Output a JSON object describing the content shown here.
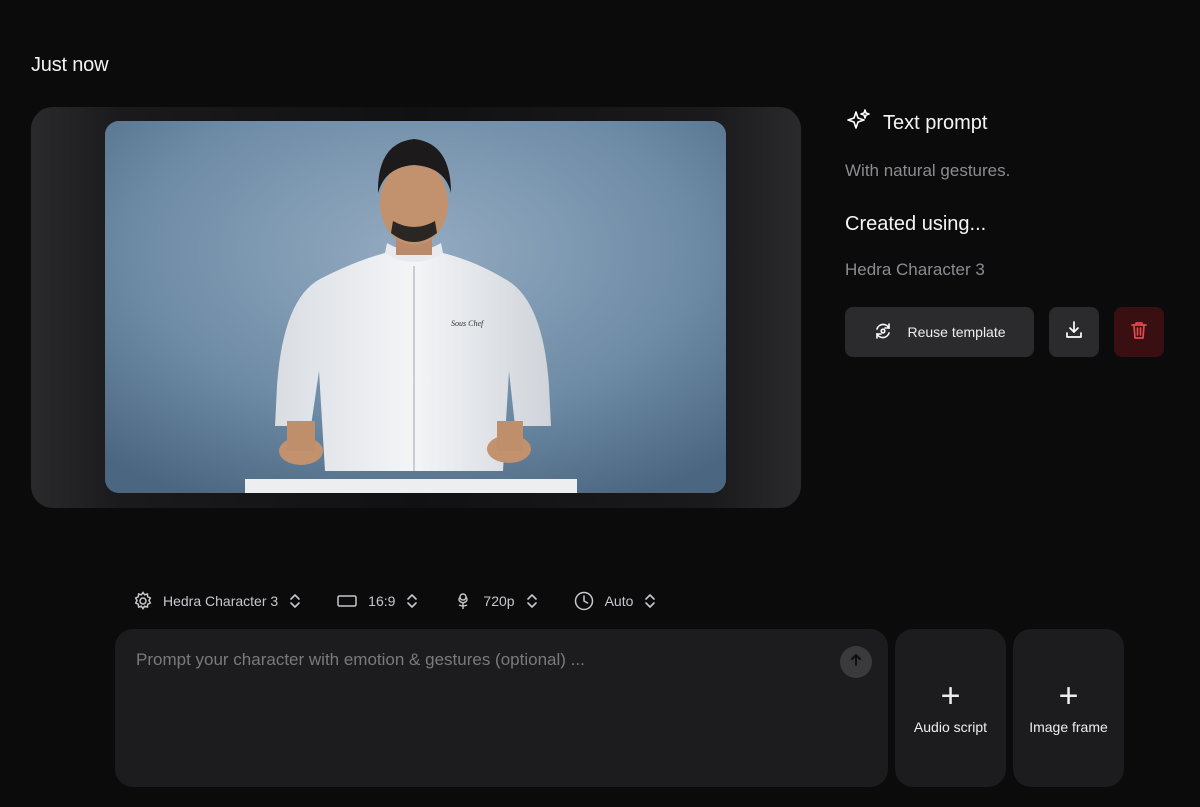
{
  "timestamp": "Just now",
  "side": {
    "text_prompt_title": "Text prompt",
    "text_prompt_value": "With natural gestures.",
    "created_using_title": "Created using...",
    "created_using_value": "Hedra Character 3",
    "reuse_label": "Reuse template"
  },
  "settings": {
    "model": "Hedra Character 3",
    "aspect": "16:9",
    "resolution": "720p",
    "duration": "Auto"
  },
  "prompt": {
    "placeholder": "Prompt your character with emotion & gestures (optional) ..."
  },
  "cards": {
    "audio": "Audio script",
    "image": "Image frame"
  },
  "colors": {
    "background": "#0b0b0c",
    "panel": "#1c1c1e",
    "danger_bg": "#3a0f12",
    "danger_icon": "#e5484d"
  },
  "icons": {
    "text_prompt": "sparkles-icon",
    "reuse": "refresh-icon",
    "download": "download-icon",
    "delete": "trash-icon",
    "model": "gear-icon",
    "aspect": "rectangle-icon",
    "resolution": "flower-icon",
    "duration": "clock-icon",
    "chevron": "chevron-updown-icon",
    "send": "arrow-up-icon",
    "add": "plus-icon"
  }
}
